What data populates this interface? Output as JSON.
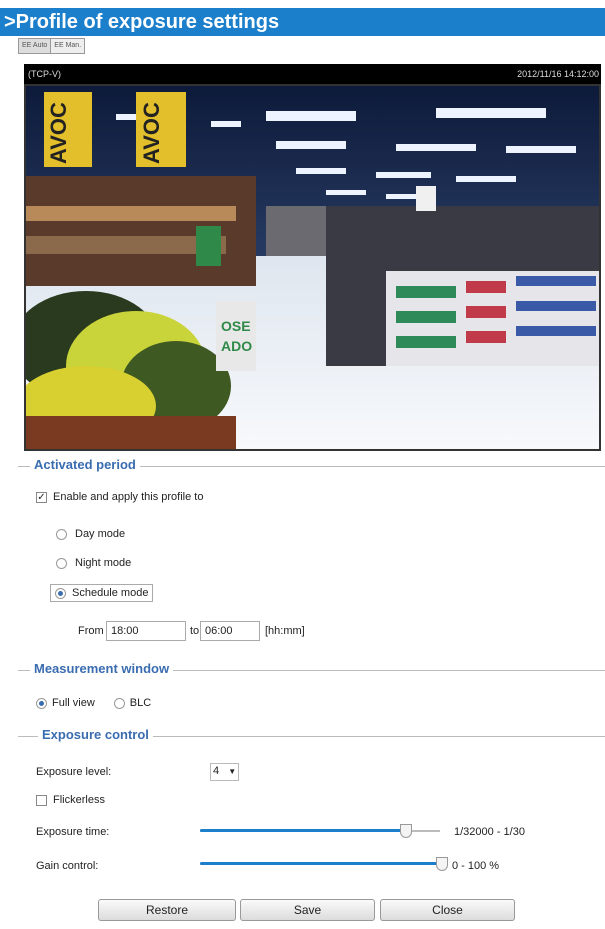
{
  "title": ">Profile of exposure settings",
  "mini_buttons": [
    "EE Auto",
    "EE Man."
  ],
  "video": {
    "stream_label": "(TCP-V)",
    "timestamp": "2012/11/16 14:12:00"
  },
  "activated_period": {
    "legend": "Activated period",
    "enable_label": "Enable and apply this profile to",
    "enable_checked": true,
    "modes": [
      {
        "label": "Day mode",
        "selected": false
      },
      {
        "label": "Night mode",
        "selected": false
      },
      {
        "label": "Schedule mode",
        "selected": true
      }
    ],
    "from_label": "From",
    "from_value": "18:00",
    "to_label": "to",
    "to_value": "06:00",
    "format_hint": "[hh:mm]"
  },
  "measurement": {
    "legend": "Measurement window",
    "options": [
      {
        "label": "Full view",
        "selected": true
      },
      {
        "label": "BLC",
        "selected": false
      }
    ]
  },
  "exposure": {
    "legend": "Exposure control",
    "level_label": "Exposure level:",
    "level_value": "4",
    "flickerless_label": "Flickerless",
    "flickerless_checked": false,
    "time_label": "Exposure time:",
    "time_range_text": "1/32000 - 1/30",
    "time_slider_fraction": 0.87,
    "gain_label": "Gain control:",
    "gain_range_text": "0 - 100 %",
    "gain_slider_fraction": 1.0
  },
  "buttons": {
    "restore": "Restore",
    "save": "Save",
    "close": "Close"
  },
  "colors": {
    "accent": "#1c7fcb",
    "legend_text": "#3a6cb0"
  }
}
